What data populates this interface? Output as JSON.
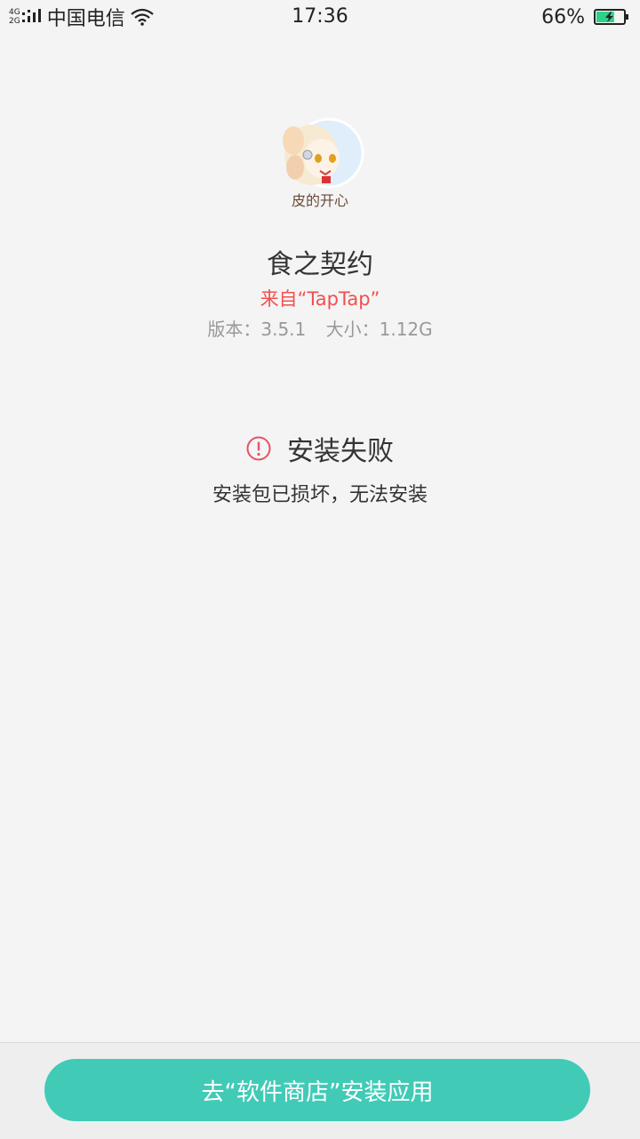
{
  "status_bar": {
    "net_type_top": "4G",
    "net_type_bottom": "2G",
    "carrier": "中国电信",
    "time": "17:36",
    "battery_percent": "66%",
    "battery_level": 0.66,
    "battery_charging": true,
    "icons": [
      "signal-icon",
      "wifi-icon",
      "battery-icon"
    ]
  },
  "app": {
    "icon_name": "app-icon-anime-girl",
    "icon_caption": "皮的开心",
    "name": "食之契约",
    "source": "来自“TapTap”",
    "version": "版本：3.5.1",
    "size": "大小：1.12G"
  },
  "result": {
    "icon_name": "alert-icon",
    "title": "安装失败",
    "description": "安装包已损坏，无法安装"
  },
  "action": {
    "store_button_label": "去“软件商店”安装应用"
  },
  "colors": {
    "background": "#f4f4f4",
    "accent": "#41cbb7",
    "source_red": "#f1504f",
    "alert_red": "#e45466",
    "meta_gray": "#999999"
  }
}
